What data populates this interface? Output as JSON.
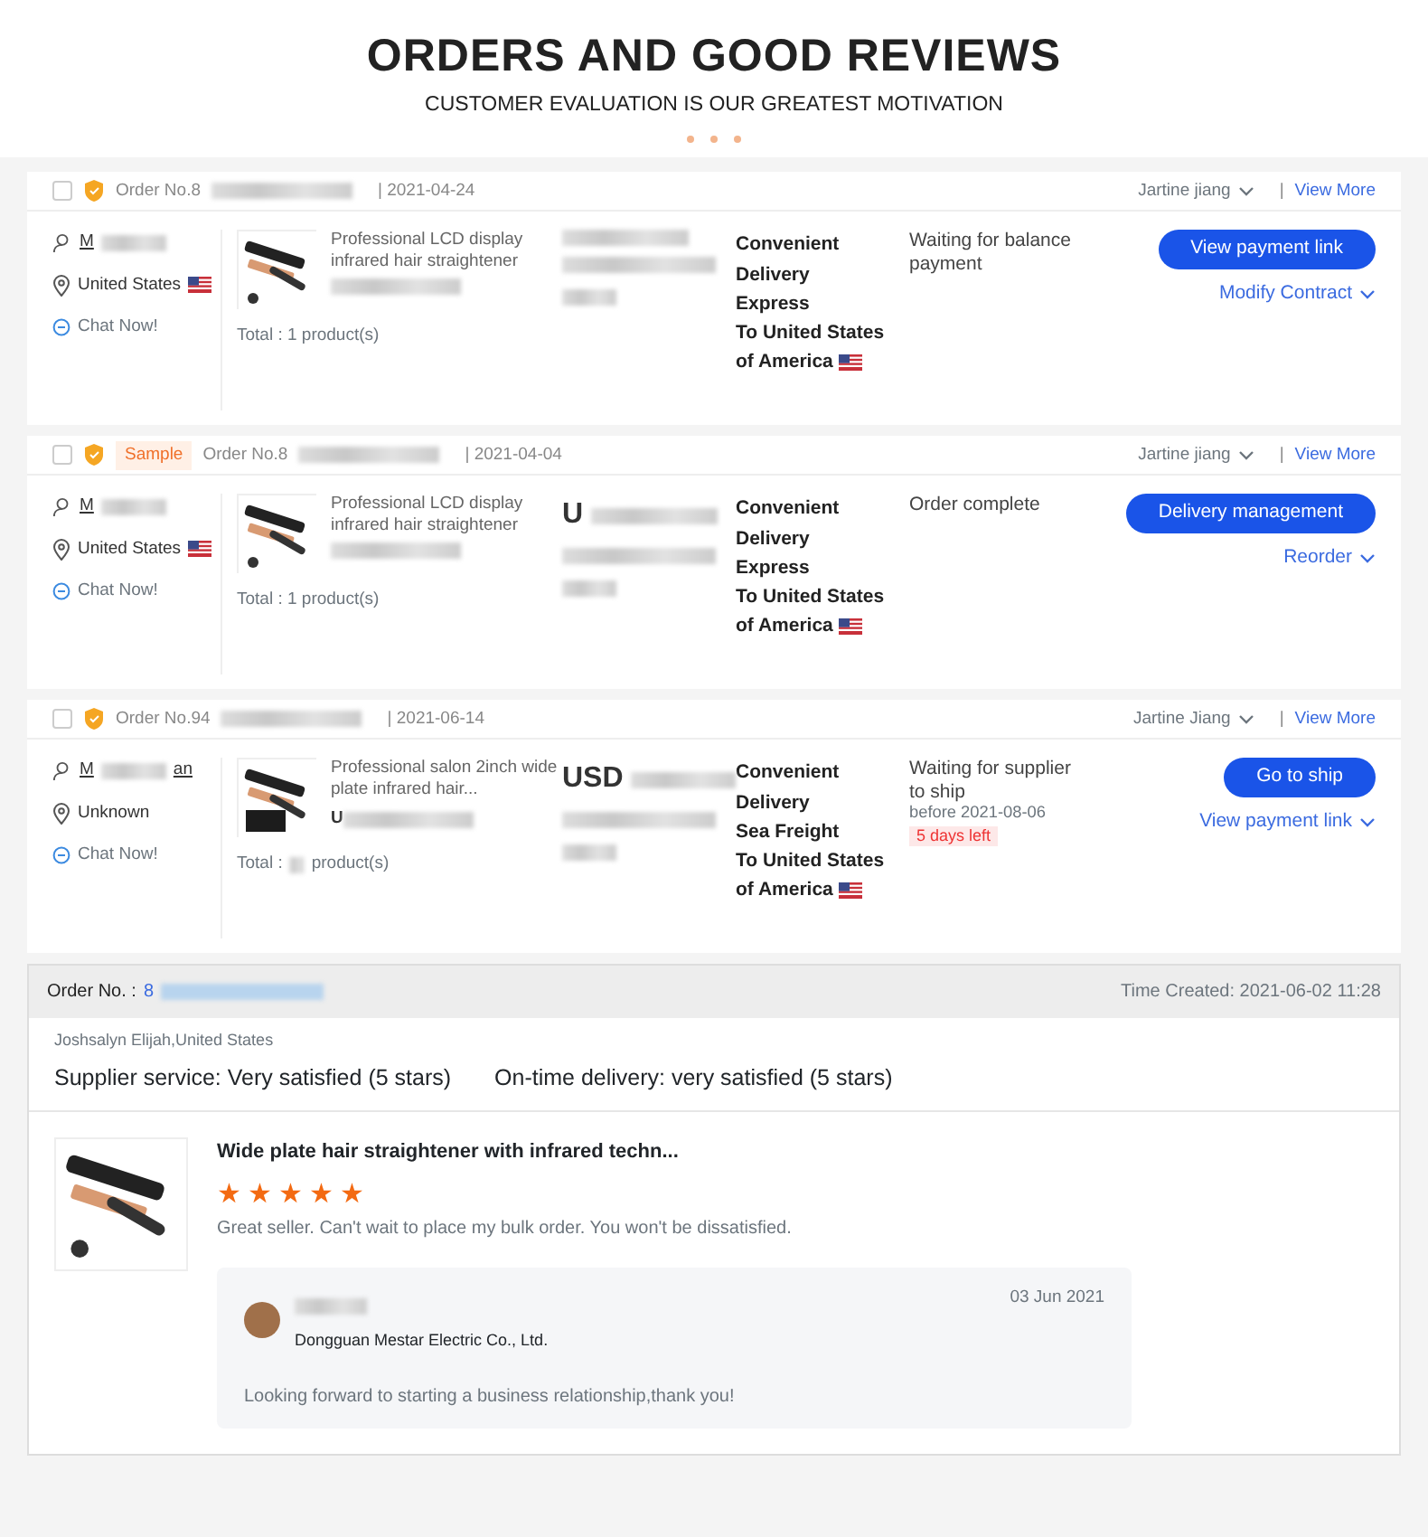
{
  "header": {
    "title": "ORDERS AND GOOD REVIEWS",
    "subtitle": "CUSTOMER EVALUATION IS OUR GREATEST MOTIVATION"
  },
  "orders": [
    {
      "checked": false,
      "order_no": "Order No.8",
      "date": "| 2021-04-24",
      "agent": "Jartine jiang",
      "separator": "|",
      "view_more": "View More",
      "customer_start": "M",
      "location": "United States",
      "us_flag": true,
      "chat": "Chat Now!",
      "product_title": "Professional LCD display infrared hair straightener",
      "total_start": "Total : 1 product(s)",
      "shipping_lines": [
        "Convenient Delivery",
        "Express",
        "To United States of America"
      ],
      "status": "Waiting for balance payment",
      "button": "View payment link",
      "link": "Modify Contract"
    },
    {
      "checked": false,
      "sample_tag": "Sample",
      "order_no": "Order No.8",
      "date": "| 2021-04-04",
      "agent": "Jartine jiang",
      "separator": "|",
      "view_more": "View More",
      "customer_start": "M",
      "location": "United States",
      "us_flag": true,
      "chat": "Chat Now!",
      "product_title": "Professional LCD display infrared hair straightener",
      "total_start": "Total : 1 product(s)",
      "amount_prefix": "U",
      "shipping_lines": [
        "Convenient Delivery",
        "Express",
        "To United States of America"
      ],
      "status": "Order complete",
      "button": "Delivery management",
      "link": "Reorder"
    },
    {
      "checked": false,
      "order_no": "Order No.94",
      "date": "| 2021-06-14",
      "agent": "Jartine Jiang",
      "separator": "|",
      "view_more": "View More",
      "customer_start": "M",
      "customer_end": "an",
      "location": "Unknown",
      "us_flag": false,
      "chat": "Chat Now!",
      "product_title": "Professional salon 2inch wide plate infrared hair...",
      "product_code": "U",
      "total_start": "Total :",
      "total_end": "product(s)",
      "amount_prefix": "USD",
      "shipping_lines": [
        "Convenient Delivery",
        "Sea Freight",
        "To United States of America"
      ],
      "status": "Waiting for supplier to ship",
      "status_note": "before 2021-08-06",
      "countdown": "5 days left",
      "button": "Go to ship",
      "link": "View payment link"
    }
  ],
  "review": {
    "order_label": "Order No. :",
    "order_no_start": "8",
    "time_created": "Time Created: 2021-06-02 11:28",
    "reviewer": "Joshsalyn Elijah,United States",
    "ratings": [
      "Supplier service: Very satisfied (5 stars)",
      "On-time delivery: very satisfied (5 stars)"
    ],
    "product_title": "Wide plate hair straightener with infrared techn...",
    "stars": 5,
    "comment": "Great seller. Can't wait to place my bulk order. You won't be dissatisfied.",
    "reply": {
      "company": "Dongguan Mestar Electric Co., Ltd.",
      "date": "03 Jun 2021",
      "text": "Looking forward to starting a business relationship,thank you!"
    }
  }
}
